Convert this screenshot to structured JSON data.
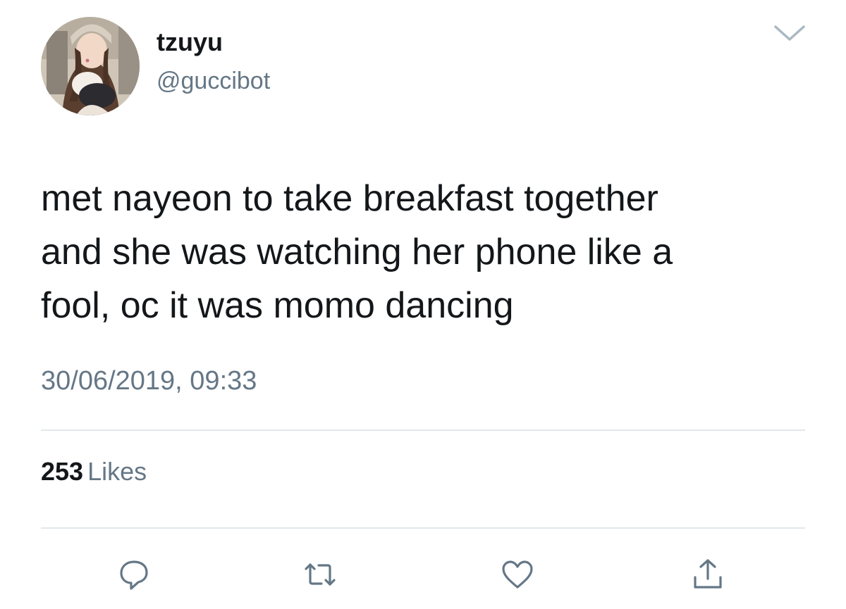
{
  "user": {
    "display_name": "tzuyu",
    "handle": "@guccibot",
    "avatar_icon": "profile-photo"
  },
  "tweet": {
    "text": "met nayeon to take breakfast together\nand she was watching her phone like a\nfool, oc it was momo dancing",
    "timestamp": "30/06/2019, 09:33"
  },
  "stats": {
    "likes_count": "253",
    "likes_label": "Likes"
  },
  "actions": [
    {
      "name": "reply",
      "icon": "reply-icon"
    },
    {
      "name": "retweet",
      "icon": "retweet-icon"
    },
    {
      "name": "like",
      "icon": "heart-icon"
    },
    {
      "name": "share",
      "icon": "share-icon"
    }
  ],
  "menu": {
    "icon": "chevron-down-icon"
  },
  "colors": {
    "text_primary": "#14171a",
    "text_secondary": "#657786",
    "divider": "#e1e8ed",
    "icon": "#657786"
  }
}
